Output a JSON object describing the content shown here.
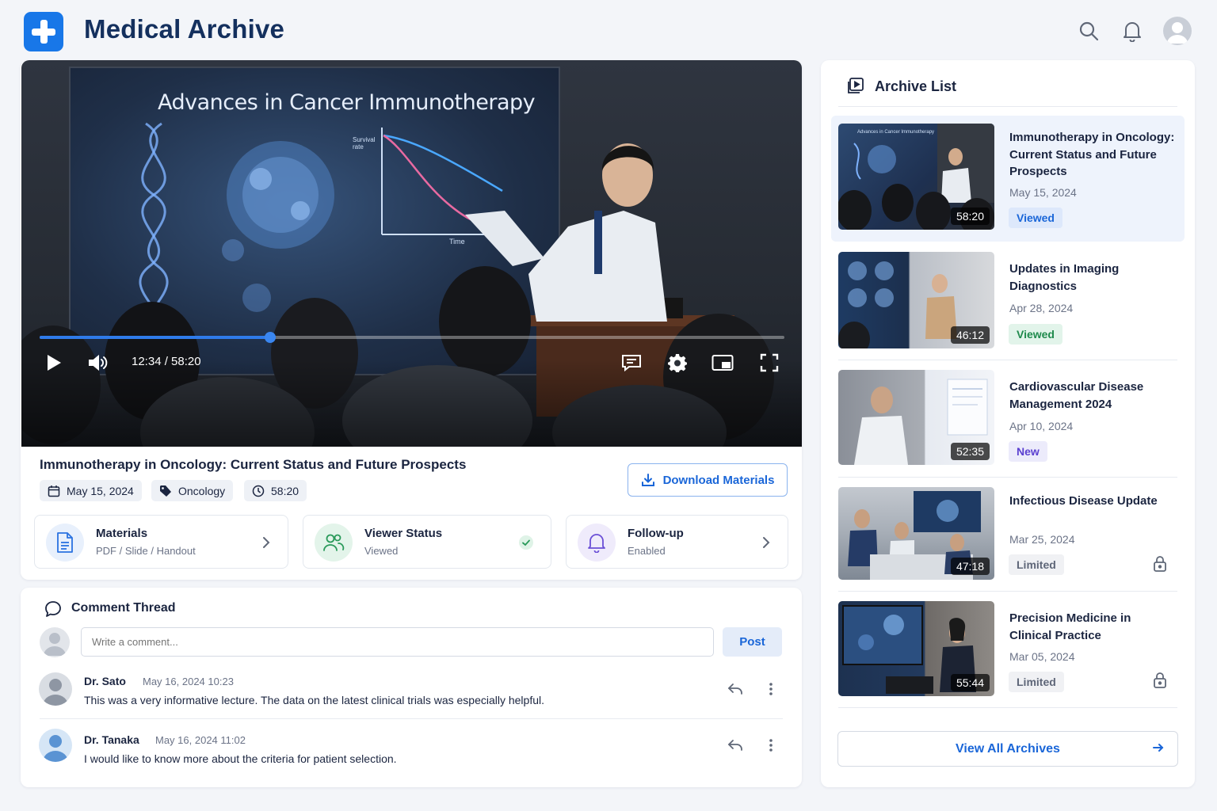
{
  "app": {
    "title": "Medical Archive"
  },
  "player": {
    "slide_title": "Advances in Cancer Immunotherapy",
    "slide_labels": {
      "y_axis": "Survival rate",
      "x_axis": "Time"
    },
    "time_display": "12:34 / 58:20",
    "progress": 0.31
  },
  "video": {
    "title": "Immunotherapy in Oncology: Current Status and Future Prospects",
    "date": "May 15, 2024",
    "category": "Oncology",
    "duration": "58:20",
    "download_label": "Download Materials"
  },
  "info_cards": [
    {
      "title": "Materials",
      "sub": "PDF / Slide / Handout"
    },
    {
      "title": "Viewer Status",
      "sub": "Viewed"
    },
    {
      "title": "Follow-up",
      "sub": "Enabled"
    }
  ],
  "comments": {
    "title": "Comment Thread",
    "placeholder": "Write a comment...",
    "post_label": "Post",
    "items": [
      {
        "author": "Dr. Sato",
        "date": "May 16, 2024 10:23",
        "text": "This was a very informative lecture. The data on the latest clinical trials was especially helpful."
      },
      {
        "author": "Dr. Tanaka",
        "date": "May 16, 2024 11:02",
        "text": "I would like to know more about the criteria for patient selection."
      }
    ]
  },
  "archive": {
    "title": "Archive List",
    "view_all": "View All Archives",
    "items": [
      {
        "title": "Immunotherapy in Oncology: Current Status and Future Prospects",
        "date": "May 15, 2024",
        "duration": "58:20",
        "badge": "Viewed",
        "thumb_text": "Advances in Cancer Immunotherapy"
      },
      {
        "title": "Updates in Imaging Diagnostics",
        "date": "Apr 28, 2024",
        "duration": "46:12",
        "badge": "Viewed"
      },
      {
        "title": "Cardiovascular Disease Management 2024",
        "date": "Apr 10, 2024",
        "duration": "52:35",
        "badge": "New"
      },
      {
        "title": "Infectious Disease Update",
        "date": "Mar 25, 2024",
        "duration": "47:18",
        "badge": "Limited"
      },
      {
        "title": "Precision Medicine in Clinical Practice",
        "date": "Mar 05, 2024",
        "duration": "55:44",
        "badge": "Limited"
      }
    ]
  },
  "colors": {
    "accent": "#1877e8",
    "brand_title": "#14305e",
    "viewed": "#1f8a4c",
    "new": "#5a3fd0"
  }
}
